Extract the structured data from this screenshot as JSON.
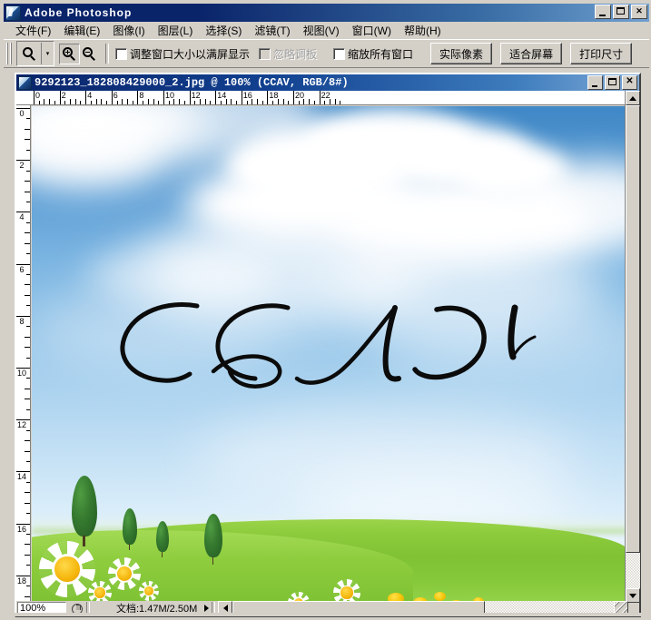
{
  "app": {
    "title": "Adobe Photoshop",
    "icon": "photoshop-icon",
    "window_controls": {
      "minimize": "_",
      "maximize": "□",
      "close": "✕"
    }
  },
  "menubar": {
    "items": [
      {
        "label": "文件(F)"
      },
      {
        "label": "编辑(E)"
      },
      {
        "label": "图像(I)"
      },
      {
        "label": "图层(L)"
      },
      {
        "label": "选择(S)"
      },
      {
        "label": "滤镜(T)"
      },
      {
        "label": "视图(V)"
      },
      {
        "label": "窗口(W)"
      },
      {
        "label": "帮助(H)"
      }
    ]
  },
  "options_bar": {
    "active_tool": "zoom-tool",
    "tool_preset_arrow": "▾",
    "zoom_in_label": "zoom-in-icon",
    "zoom_out_label": "zoom-out-icon",
    "checkboxes": [
      {
        "label": "调整窗口大小以满屏显示",
        "checked": false,
        "disabled": false
      },
      {
        "label": "忽略调板",
        "checked": false,
        "disabled": true
      },
      {
        "label": "缩放所有窗口",
        "checked": false,
        "disabled": false
      }
    ],
    "buttons": [
      {
        "label": "实际像素"
      },
      {
        "label": "适合屏幕"
      },
      {
        "label": "打印尺寸"
      }
    ]
  },
  "document": {
    "title": "9292123_182808429000_2.jpg @ 100%  (CCAV,  RGB/8#)",
    "filename": "9292123_182808429000_2.jpg",
    "zoom": "100%",
    "layer_name": "CCAV",
    "color_mode": "RGB/8#",
    "window_controls": {
      "minimize": "_",
      "maximize": "□",
      "close": "✕"
    }
  },
  "rulers": {
    "unit_hint": "cm",
    "horizontal_labels": [
      "0",
      "2",
      "4",
      "6",
      "8",
      "10",
      "12",
      "14",
      "16",
      "18",
      "20",
      "22"
    ],
    "vertical_labels": [
      "0",
      "2",
      "4",
      "6",
      "8",
      "10",
      "12",
      "14",
      "16",
      "18"
    ]
  },
  "canvas": {
    "artwork_text": "CCAV",
    "artwork_style": "black-calligraphic-script",
    "scene": "blue sky with white clouds above green grass hills with cypress trees and daisies",
    "colors": {
      "sky_top": "#3f87c6",
      "sky_bottom": "#cfe9fa",
      "cloud": "#ffffff",
      "grass": "#8ccb3c",
      "tree": "#35792f",
      "daisy_center": "#f5b60c",
      "ink": "#0b0b0b"
    }
  },
  "status_bar": {
    "zoom_value": "100%",
    "doc_size_label": "文档:1.47M/2.50M",
    "arrow": "▶"
  },
  "scrollbars": {
    "vertical": {
      "up": "▲",
      "down": "▼"
    },
    "horizontal": {
      "left": "◀",
      "right": "▶"
    }
  }
}
